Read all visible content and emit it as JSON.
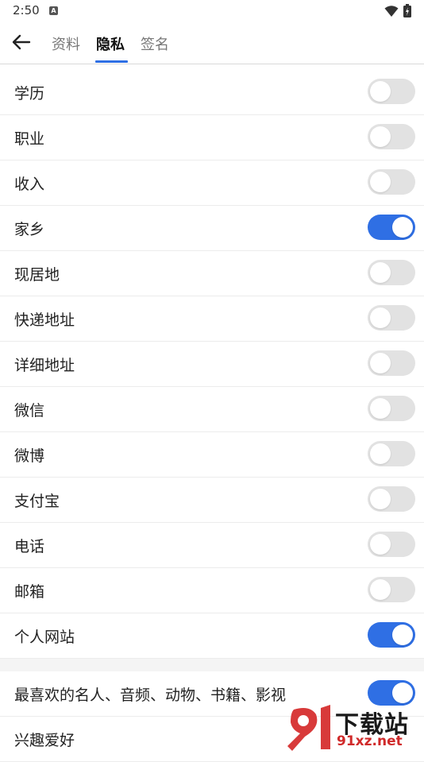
{
  "status_bar": {
    "time": "2:50",
    "notification_icon": "A"
  },
  "tabs": [
    {
      "label": "资料"
    },
    {
      "label": "隐私"
    },
    {
      "label": "签名"
    }
  ],
  "active_tab": "隐私",
  "accent_color": "#2f6fe4",
  "privacy_items": [
    {
      "label": "学历",
      "enabled": false
    },
    {
      "label": "职业",
      "enabled": false
    },
    {
      "label": "收入",
      "enabled": false
    },
    {
      "label": "家乡",
      "enabled": true
    },
    {
      "label": "现居地",
      "enabled": false
    },
    {
      "label": "快递地址",
      "enabled": false
    },
    {
      "label": "详细地址",
      "enabled": false
    },
    {
      "label": "微信",
      "enabled": false
    },
    {
      "label": "微博",
      "enabled": false
    },
    {
      "label": "支付宝",
      "enabled": false
    },
    {
      "label": "电话",
      "enabled": false
    },
    {
      "label": "邮箱",
      "enabled": false
    },
    {
      "label": "个人网站",
      "enabled": true
    }
  ],
  "interest_items": [
    {
      "label": "最喜欢的名人、音频、动物、书籍、影视",
      "enabled": true
    },
    {
      "label": "兴趣爱好",
      "enabled": null
    }
  ],
  "watermark": {
    "text": "下载站",
    "url": "91xz.net"
  }
}
